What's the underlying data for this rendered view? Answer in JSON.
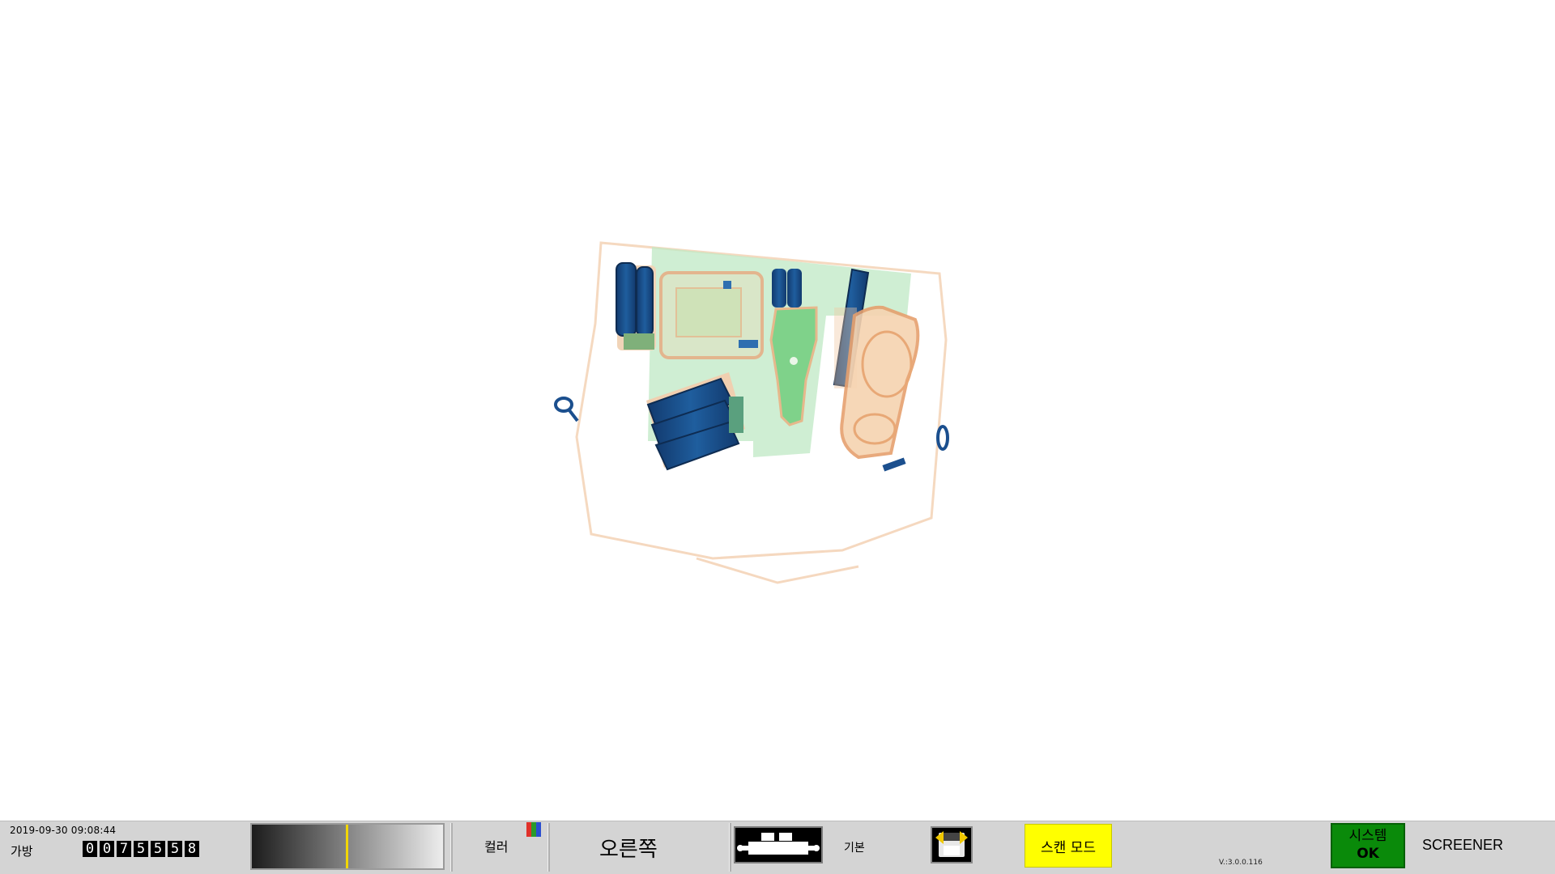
{
  "scan_view": {
    "colors": {
      "organic": "#e8a06a",
      "mixed": "#5fd07a",
      "inorganic": "#1b4f8e",
      "background": "#ffffff"
    }
  },
  "status_bar": {
    "datetime": "2019-09-30 09:08:44",
    "bag_label": "가방",
    "bag_counter_digits": [
      "0",
      "0",
      "7",
      "5",
      "5",
      "5",
      "8"
    ],
    "gradient_level": 0.49,
    "color_label": "컬러",
    "color_icon": "rgb-bars-icon",
    "direction_label": "오른쪽",
    "belt_icon": "conveyor-belt-icon",
    "basic_label": "기본",
    "save_icon": "save-disk-icon",
    "scan_mode_label": "스캔 모드",
    "version": "V.:3.0.0.116",
    "system_label": "시스템",
    "system_status": "OK",
    "role": "SCREENER",
    "status_colors": {
      "ok": "#0a8a0a",
      "scan_mode": "#ffff00"
    }
  }
}
